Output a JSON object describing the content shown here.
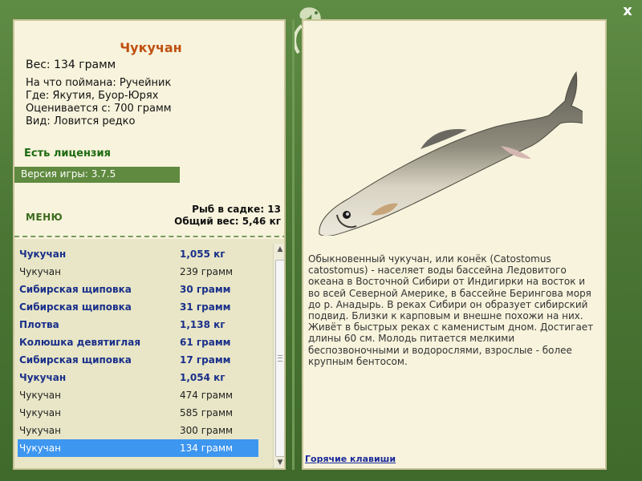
{
  "fish": {
    "name": "Чукучан",
    "weight": "Вес: 134 грамм",
    "bait": "На что поймана: Ручейник",
    "location": "Где: Якутия, Буор-Юрях",
    "value": "Оценивается с: 700 грамм",
    "rarity": "Вид: Ловится редко"
  },
  "license": "Есть лицензия",
  "version": "Версия игры: 3.7.5",
  "menu_label": "МЕНЮ",
  "stats": {
    "count": "Рыб в садке: 13",
    "total": "Общий вес: 5,46 кг"
  },
  "catch_list": [
    {
      "name": "Чукучан",
      "weight": "1,055 кг",
      "big": true
    },
    {
      "name": "Чукучан",
      "weight": "239 грамм",
      "big": false
    },
    {
      "name": "Сибирская щиповка",
      "weight": "30 грамм",
      "big": true
    },
    {
      "name": "Сибирская щиповка",
      "weight": "31 грамм",
      "big": true
    },
    {
      "name": "Плотва",
      "weight": "1,138 кг",
      "big": true
    },
    {
      "name": "Колюшка девятиглая",
      "weight": "61 грамм",
      "big": true
    },
    {
      "name": "Сибирская щиповка",
      "weight": "17 грамм",
      "big": true
    },
    {
      "name": "Чукучан",
      "weight": "1,054 кг",
      "big": true
    },
    {
      "name": "Чукучан",
      "weight": "474 грамм",
      "big": false
    },
    {
      "name": "Чукучан",
      "weight": "585 грамм",
      "big": false
    },
    {
      "name": "Чукучан",
      "weight": "300 грамм",
      "big": false
    },
    {
      "name": "Чукучан",
      "weight": "134 грамм",
      "big": false,
      "selected": true
    }
  ],
  "description": "Обыкновенный чукучан, или конёк (Catostomus catostomus) - населяет воды бассейна Ледовитого океана в Восточной Сибири от Индигирки на восток и во всей Северной Америке, в бассейне Берингова моря до р. Анадырь. В реках Сибири он образует сибирский подвид. Близки к карповым и внешне похожи на них. Живёт в быстрых реках с каменистым дном. Достигает длины 60 см. Молодь питается мелкими беспозвоночными и водорослями, взрослые - более крупным бентосом.",
  "hotkeys_label": "Горячие клавиши",
  "close_label": "x",
  "colors": {
    "frame": "#4f7a3a",
    "panel": "#f7f3dc",
    "fish_name": "#c05010",
    "big_fish": "#1a2f8a",
    "selected_row": "#3d96f0"
  },
  "icons": {
    "logo": "leaf-logo-icon",
    "close": "close-icon"
  }
}
